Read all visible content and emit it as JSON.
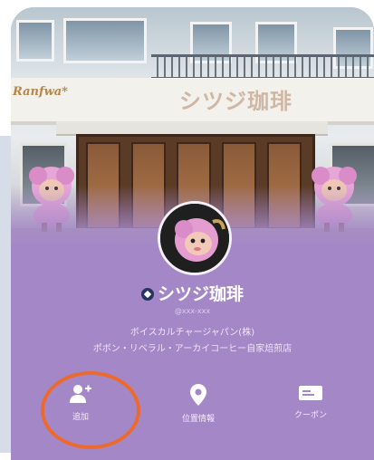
{
  "cover": {
    "sign_left": "Ranfwa*",
    "sign_main": "シツジ珈琲"
  },
  "profile": {
    "name": "シツジ珈琲",
    "id_line": "@ххх-ххх",
    "desc_line1": "ボイスカルチャージャパン(株)",
    "desc_line2": "ポボン・リベラル・アーカイコーヒー自家焙煎店"
  },
  "actions": [
    {
      "label": "追加",
      "icon": "add-friend-icon"
    },
    {
      "label": "位置情報",
      "icon": "location-pin-icon"
    },
    {
      "label": "クーポン",
      "icon": "coupon-icon"
    }
  ],
  "colors": {
    "card": "#a487c6",
    "highlight_circle": "#ec6a2d"
  }
}
